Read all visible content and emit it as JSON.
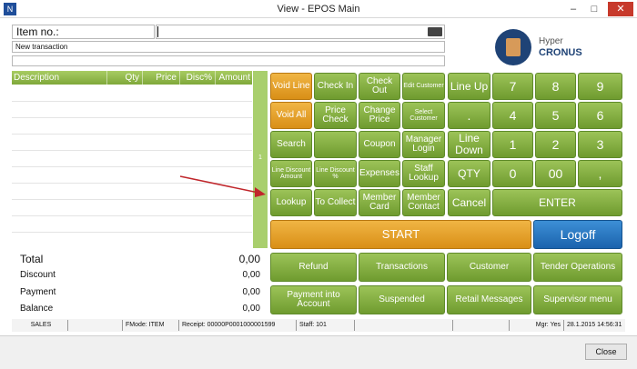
{
  "window": {
    "title": "View - EPOS Main",
    "icon_text": "N"
  },
  "item": {
    "label": "Item no.:",
    "value": ""
  },
  "transaction": {
    "label": "New transaction"
  },
  "logo": {
    "line1": "Hyper",
    "line2": "CRONUS"
  },
  "grid": {
    "columns": [
      "Description",
      "Qty",
      "Price",
      "Disc%",
      "Amount"
    ]
  },
  "scroll": {
    "label": "1"
  },
  "totals": [
    {
      "label": "Total",
      "value": "0,00"
    },
    {
      "label": "Discount",
      "value": "0,00"
    },
    {
      "label": "Payment",
      "value": "0,00"
    },
    {
      "label": "Balance",
      "value": "0,00"
    }
  ],
  "buttons": {
    "void_line": "Void Line",
    "check_in": "Check In",
    "check_out": "Check Out",
    "edit_customer": "Edit Customer",
    "void_all": "Void All",
    "price_check": "Price Check",
    "change_price": "Change Price",
    "select_customer": "Select Customer",
    "search": "Search",
    "coupon": "Coupon",
    "manager_login": "Manager Login",
    "line_discount_amount": "Line Discount Amount",
    "line_discount_pct": "Line Discount %",
    "expenses": "Expenses",
    "staff_lookup": "Staff Lookup",
    "lookup": "Lookup",
    "to_collect": "To Collect",
    "member_card": "Member Card",
    "member_contact": "Member Contact",
    "line_up": "Line Up",
    "dot": ".",
    "line_down": "Line Down",
    "qty": "QTY",
    "cancel": "Cancel",
    "enter": "ENTER",
    "n7": "7",
    "n8": "8",
    "n9": "9",
    "n4": "4",
    "n5": "5",
    "n6": "6",
    "n1": "1",
    "n2": "2",
    "n3": "3",
    "n0": "0",
    "n00": "00",
    "comma": ",",
    "start": "START",
    "logoff": "Logoff",
    "refund": "Refund",
    "transactions": "Transactions",
    "customer": "Customer",
    "tender_operations": "Tender Operations",
    "payment_into_account": "Payment into Account",
    "suspended": "Suspended",
    "retail_messages": "Retail Messages",
    "supervisor_menu": "Supervisor menu"
  },
  "status": {
    "mode": "SALES",
    "fmode": "FMode: ITEM",
    "receipt": "Receipt: 00000P0001000001599",
    "staff": "Staff: 101",
    "mgr": "Mgr: Yes",
    "datetime": "28.1.2015 14:56:31"
  },
  "footer": {
    "close": "Close"
  },
  "colors": {
    "green": "#7fa83a",
    "orange": "#e0a02a",
    "blue": "#1f6fbf"
  }
}
